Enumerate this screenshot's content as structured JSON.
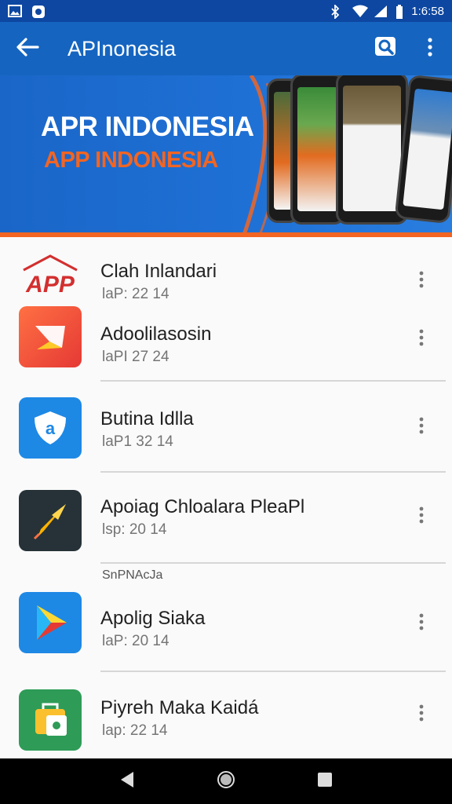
{
  "status_bar": {
    "time": "1:6:58",
    "icons": [
      "image-icon",
      "app-notification-icon",
      "bluetooth-icon",
      "wifi-icon",
      "signal-icon",
      "battery-icon"
    ]
  },
  "app_bar": {
    "title": "APInonesia",
    "back_icon": "back-arrow-icon",
    "search_icon": "search-icon",
    "menu_icon": "more-vert-icon"
  },
  "banner": {
    "title": "APR INDONESIA",
    "subtitle": "APP INDONESIA",
    "accent_color": "#f26522"
  },
  "list": {
    "items": [
      {
        "title": "Clah Inlandari",
        "subtitle": "laP: 22  14",
        "icon": "app-logo-icon"
      },
      {
        "title": "Adoolilasosin",
        "subtitle": "laPI 27  24",
        "icon": "arrow-tile-icon"
      },
      {
        "title": "Butina Idlla",
        "subtitle": "laP1 32  14",
        "icon": "shield-icon"
      },
      {
        "title": "Apoiag Chloalara PleaPl",
        "subtitle": "lsp: 20  14",
        "icon": "pen-icon"
      },
      {
        "title": "Apolig Siaka",
        "subtitle": "laP: 20  14",
        "icon": "play-triangle-icon"
      },
      {
        "title": "Piyreh Maka Kaidá",
        "subtitle": "lap: 22  14",
        "icon": "bag-icon"
      }
    ],
    "section_label": "SnPNAcJa"
  },
  "nav_bar": {
    "back_icon": "nav-back-icon",
    "home_icon": "nav-home-icon",
    "recents_icon": "nav-recents-icon"
  }
}
